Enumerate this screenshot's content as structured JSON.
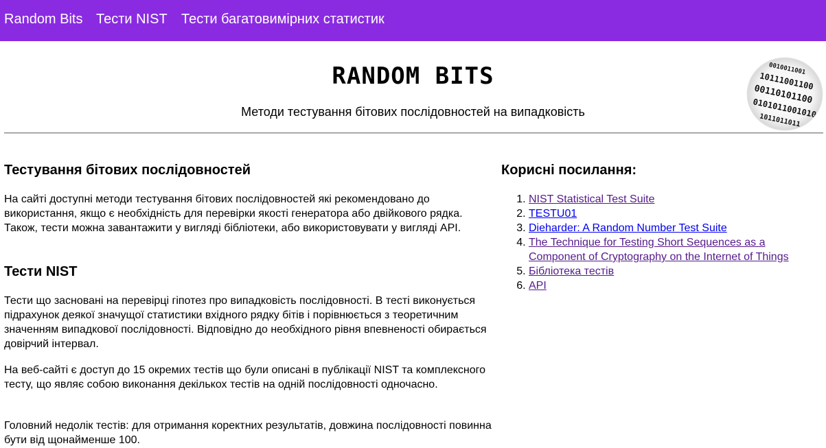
{
  "nav": {
    "items": [
      {
        "label": "Random Bits"
      },
      {
        "label": "Тести NIST"
      },
      {
        "label": "Тести багатовимірних статистик"
      }
    ]
  },
  "header": {
    "title": "RANDOM BITS",
    "subtitle": "Методи тестування бітових послідовностей на випадковість",
    "logo_icon": "binary-globe-icon"
  },
  "main": {
    "section1_title": "Тестування бітових послідовностей",
    "section1_text": "На сайті доступні методи тестування бітових послідовностей які рекомендовано до використання, якщо є необхідність для перевірки якості генератора або двійкового рядка. Також, тести можна завантажити у вигляді бібліотеки, або використовувати у вигляді API.",
    "section2_title": "Тести NIST",
    "section2_p1": "Тести що засновані на перевірці гіпотез про випадковість послідовності. В тесті виконується підрахунок деякої значущої статистики вхідного рядку бітів і порівнюється з теоретичним значенням випадкової послідовності. Відповідно до необхідного рівня впевненості обирається довірчий інтервал.",
    "section2_p2": "На веб-сайті є доступ до 15 окремих тестів що були описані в публікації NIST та комплексного тесту, що являє собою виконання декількох тестів на одній послідовності одночасно.",
    "section2_p3": "Головний недолік тестів: для отримання коректних результатів, довжина послідовності повинна бути від щонайменше 100."
  },
  "side": {
    "title": "Корисні посилання:",
    "links": [
      {
        "label": "NIST Statistical Test Suite"
      },
      {
        "label": "TESTU01"
      },
      {
        "label": "Diehard‍er: A Random Number Test Suite"
      },
      {
        "label": "The Technique for Testing Short Sequences as a Component of Cryptography on the Internet of Things"
      },
      {
        "label": "Бібліотека тестів"
      },
      {
        "label": "API"
      }
    ]
  },
  "colors": {
    "navbar": "#8a2be2",
    "link_visited": "#551a8b",
    "link_unvisited": "#0000ee"
  }
}
